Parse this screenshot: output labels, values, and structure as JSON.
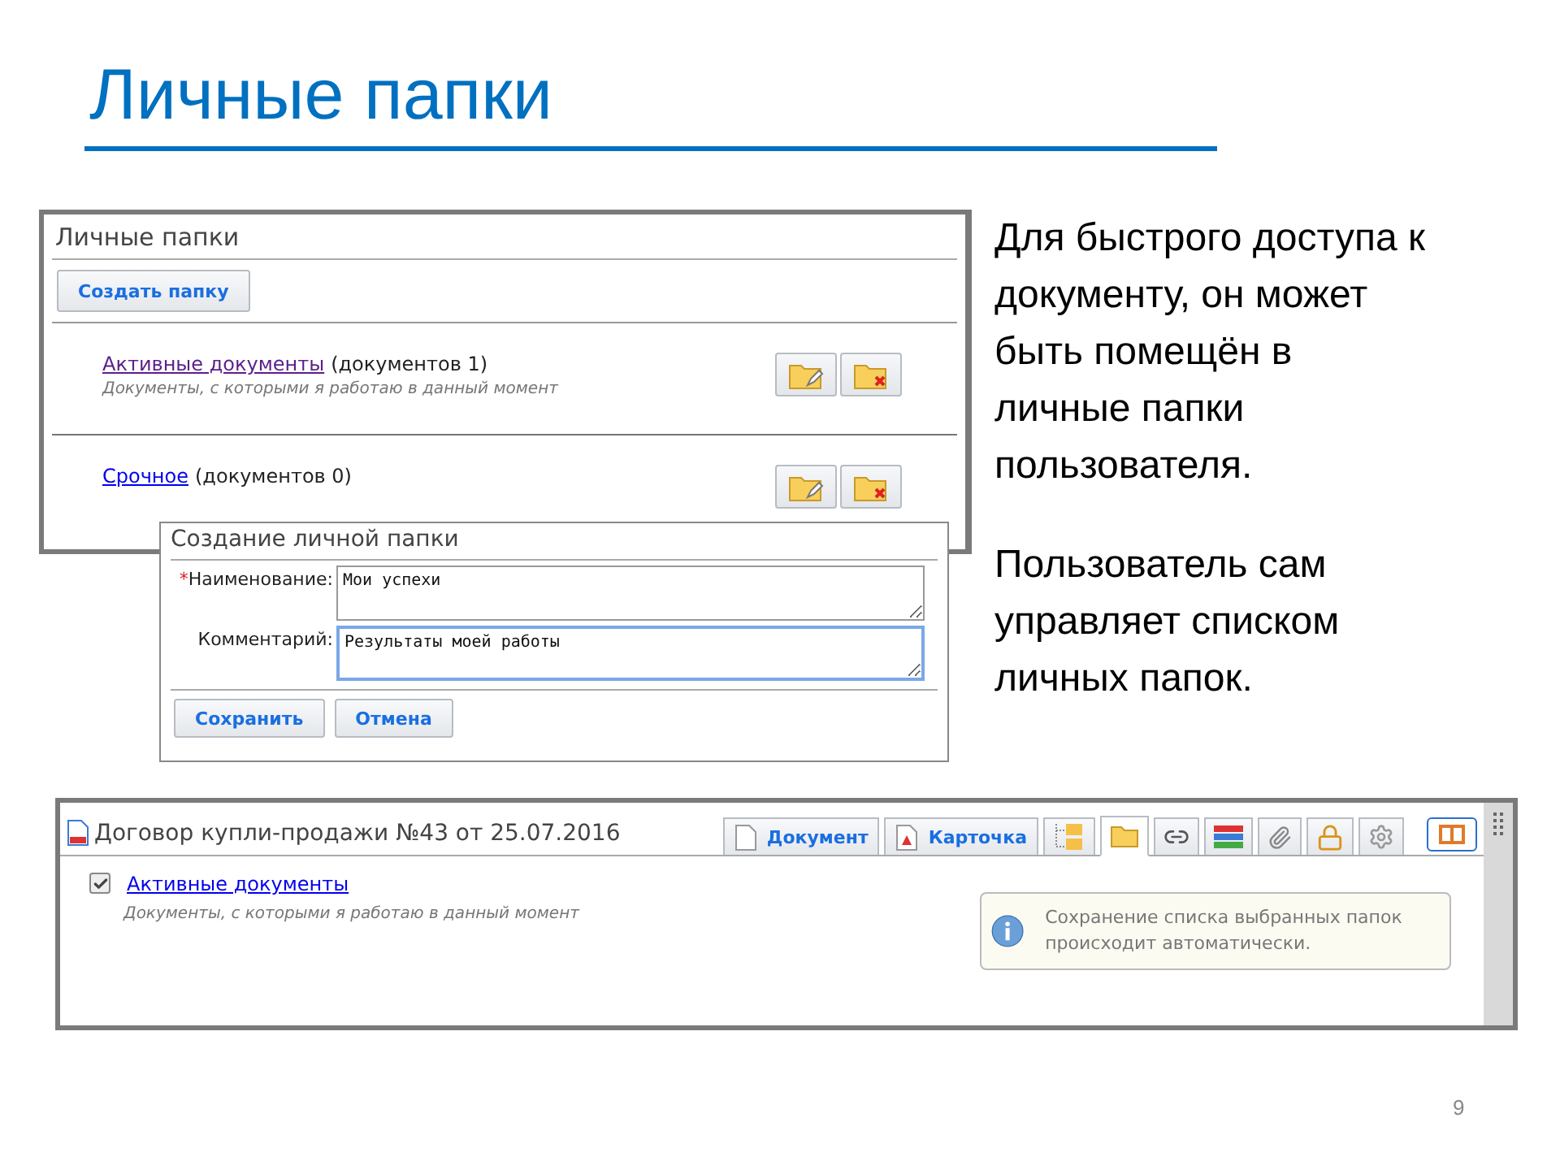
{
  "slide": {
    "title": "Личные папки",
    "page_number": "9",
    "paragraphs": [
      "Для быстрого доступа к документу, он может быть помещён в личные папки пользователя.",
      "Пользователь сам управляет списком личных папок."
    ]
  },
  "folders_panel": {
    "title": "Личные папки",
    "create_button": "Создать папку",
    "folders": [
      {
        "name": "Активные документы",
        "count": "(документов 1)",
        "description": "Документы, с которыми я работаю в данный момент",
        "visited": true
      },
      {
        "name": "Срочное",
        "count": "(документов 0)",
        "visited": false
      }
    ]
  },
  "create_dialog": {
    "title": "Создание личной папки",
    "fields": [
      {
        "label": "Наименование:",
        "required_mark": "*",
        "value": "Мои успехи",
        "focused": false
      },
      {
        "label": "Комментарий:",
        "value": "Результаты моей работы",
        "focused": true
      }
    ],
    "buttons": [
      "Сохранить",
      "Отмена"
    ]
  },
  "document_window": {
    "title": "Договор купли-продажи №43 от 25.07.2016",
    "tabs": [
      {
        "kind": "text",
        "label": "Документ",
        "selected": false
      },
      {
        "kind": "text",
        "label": "Карточка",
        "selected": false
      },
      {
        "kind": "icon",
        "selected": false
      },
      {
        "kind": "icon",
        "selected": true
      },
      {
        "kind": "icon",
        "selected": false
      },
      {
        "kind": "icon",
        "selected": false
      },
      {
        "kind": "icon",
        "selected": false
      },
      {
        "kind": "icon",
        "selected": false
      },
      {
        "kind": "icon",
        "selected": false
      }
    ],
    "folders": [
      {
        "name": "Активные документы",
        "description": "Документы, с которыми я работаю в данный момент",
        "checked": true
      }
    ],
    "notice": "Сохранение списка выбранных папок происходит автоматически."
  }
}
